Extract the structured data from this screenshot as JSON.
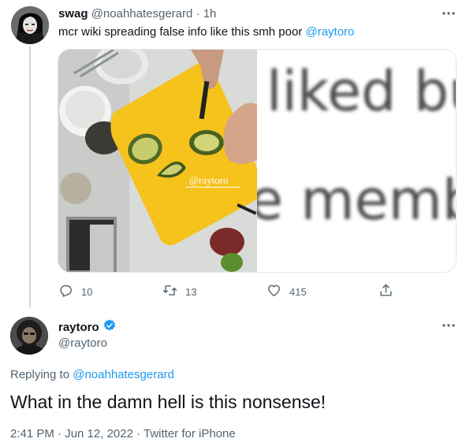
{
  "reply_tweet": {
    "display_name": "swag",
    "handle": "@noahhatesgerard",
    "separator": "·",
    "time": "1h",
    "text_prefix": "mcr wiki spreading false info like this smh poor ",
    "text_mention": "@raytoro",
    "media": {
      "photo_overlay": "@raytoro",
      "blurred_line_1": "liked bu",
      "blurred_line_2": "e memb"
    },
    "actions": {
      "replies": "10",
      "retweets": "13",
      "likes": "415"
    },
    "icons": [
      "more-icon",
      "reply-icon",
      "retweet-icon",
      "like-icon",
      "share-icon"
    ]
  },
  "main_tweet": {
    "display_name": "raytoro",
    "handle": "@raytoro",
    "verified": true,
    "replying_label": "Replying to ",
    "replying_handle": "@noahhatesgerard",
    "text": "What in the damn hell is this nonsense!",
    "meta": "2:41 PM · Jun 12, 2022 · Twitter for iPhone"
  },
  "colors": {
    "accent": "#1d9bf0",
    "text_primary": "#0f1419",
    "text_secondary": "#536471",
    "thread_line": "#cfd9de",
    "board_yellow": "#f6c21c"
  }
}
